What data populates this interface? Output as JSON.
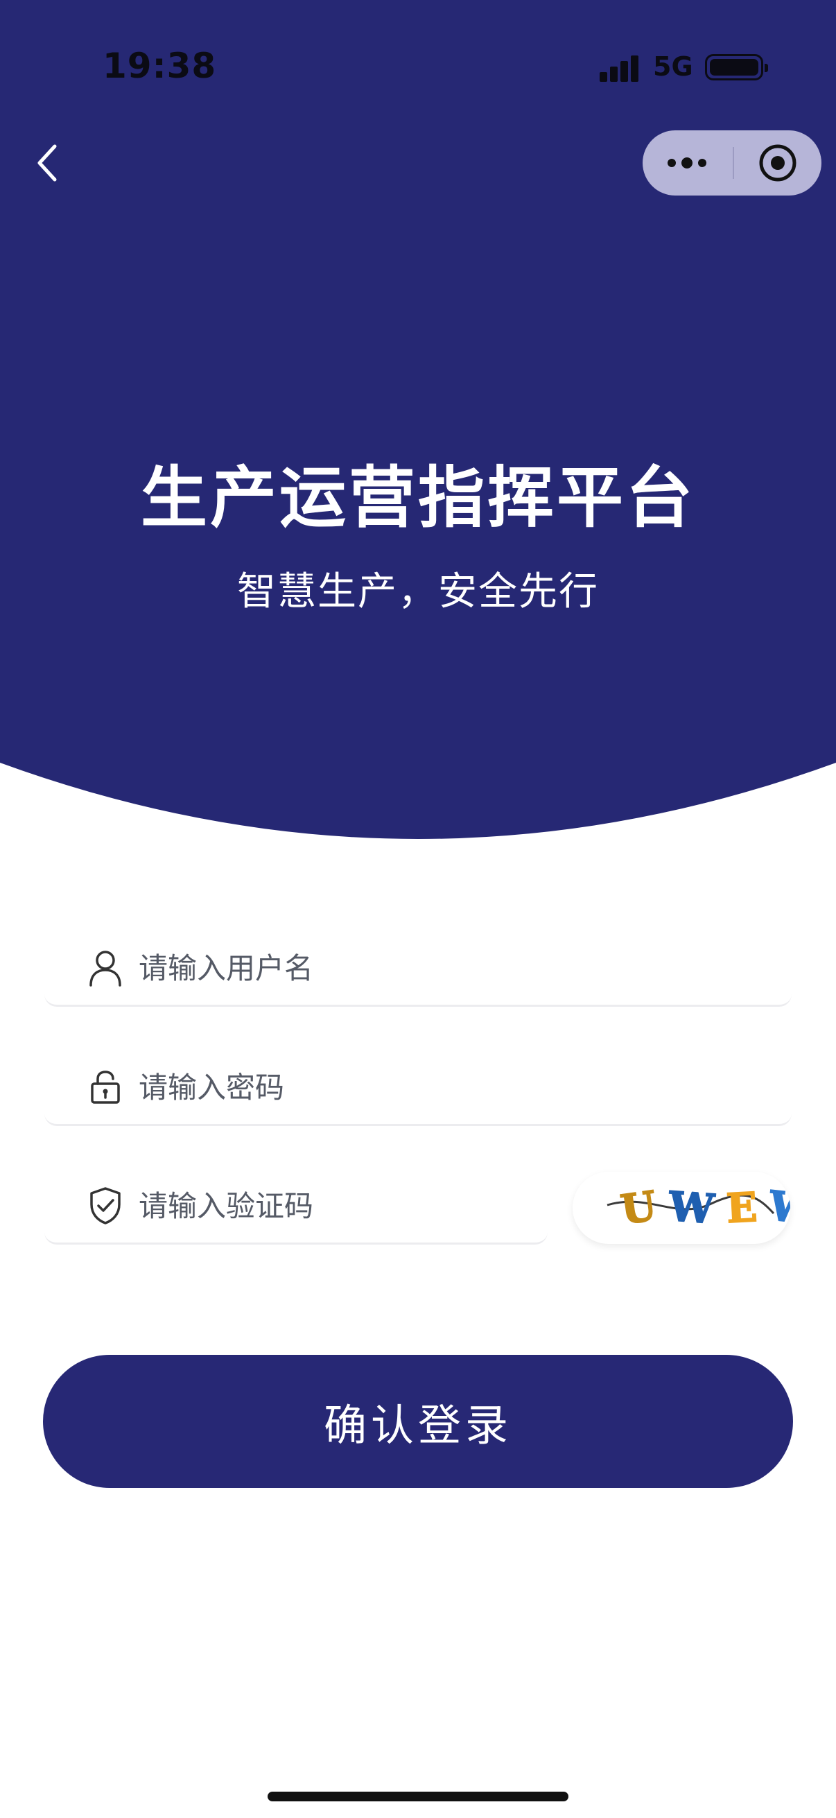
{
  "status_bar": {
    "time": "19:38",
    "network": "5G"
  },
  "nav": {
    "back_icon": "chevron-left-icon",
    "more_icon": "ellipsis-icon",
    "close_icon": "target-circle-icon"
  },
  "hero": {
    "title": "生产运营指挥平台",
    "subtitle": "智慧生产，安全先行"
  },
  "form": {
    "username": {
      "placeholder": "请输入用户名",
      "value": "",
      "icon": "user-icon"
    },
    "password": {
      "placeholder": "请输入密码",
      "value": "",
      "icon": "lock-icon"
    },
    "captcha": {
      "placeholder": "请输入验证码",
      "value": "",
      "icon": "shield-check-icon",
      "image_text": [
        "U",
        "W",
        "E",
        "W"
      ]
    },
    "submit_label": "确认登录"
  },
  "colors": {
    "brand": "#262874",
    "capsule": "#b6b5d8",
    "captcha_chars": [
      "#c48a16",
      "#1f5fb0",
      "#f0a41e",
      "#2d79cf"
    ]
  }
}
